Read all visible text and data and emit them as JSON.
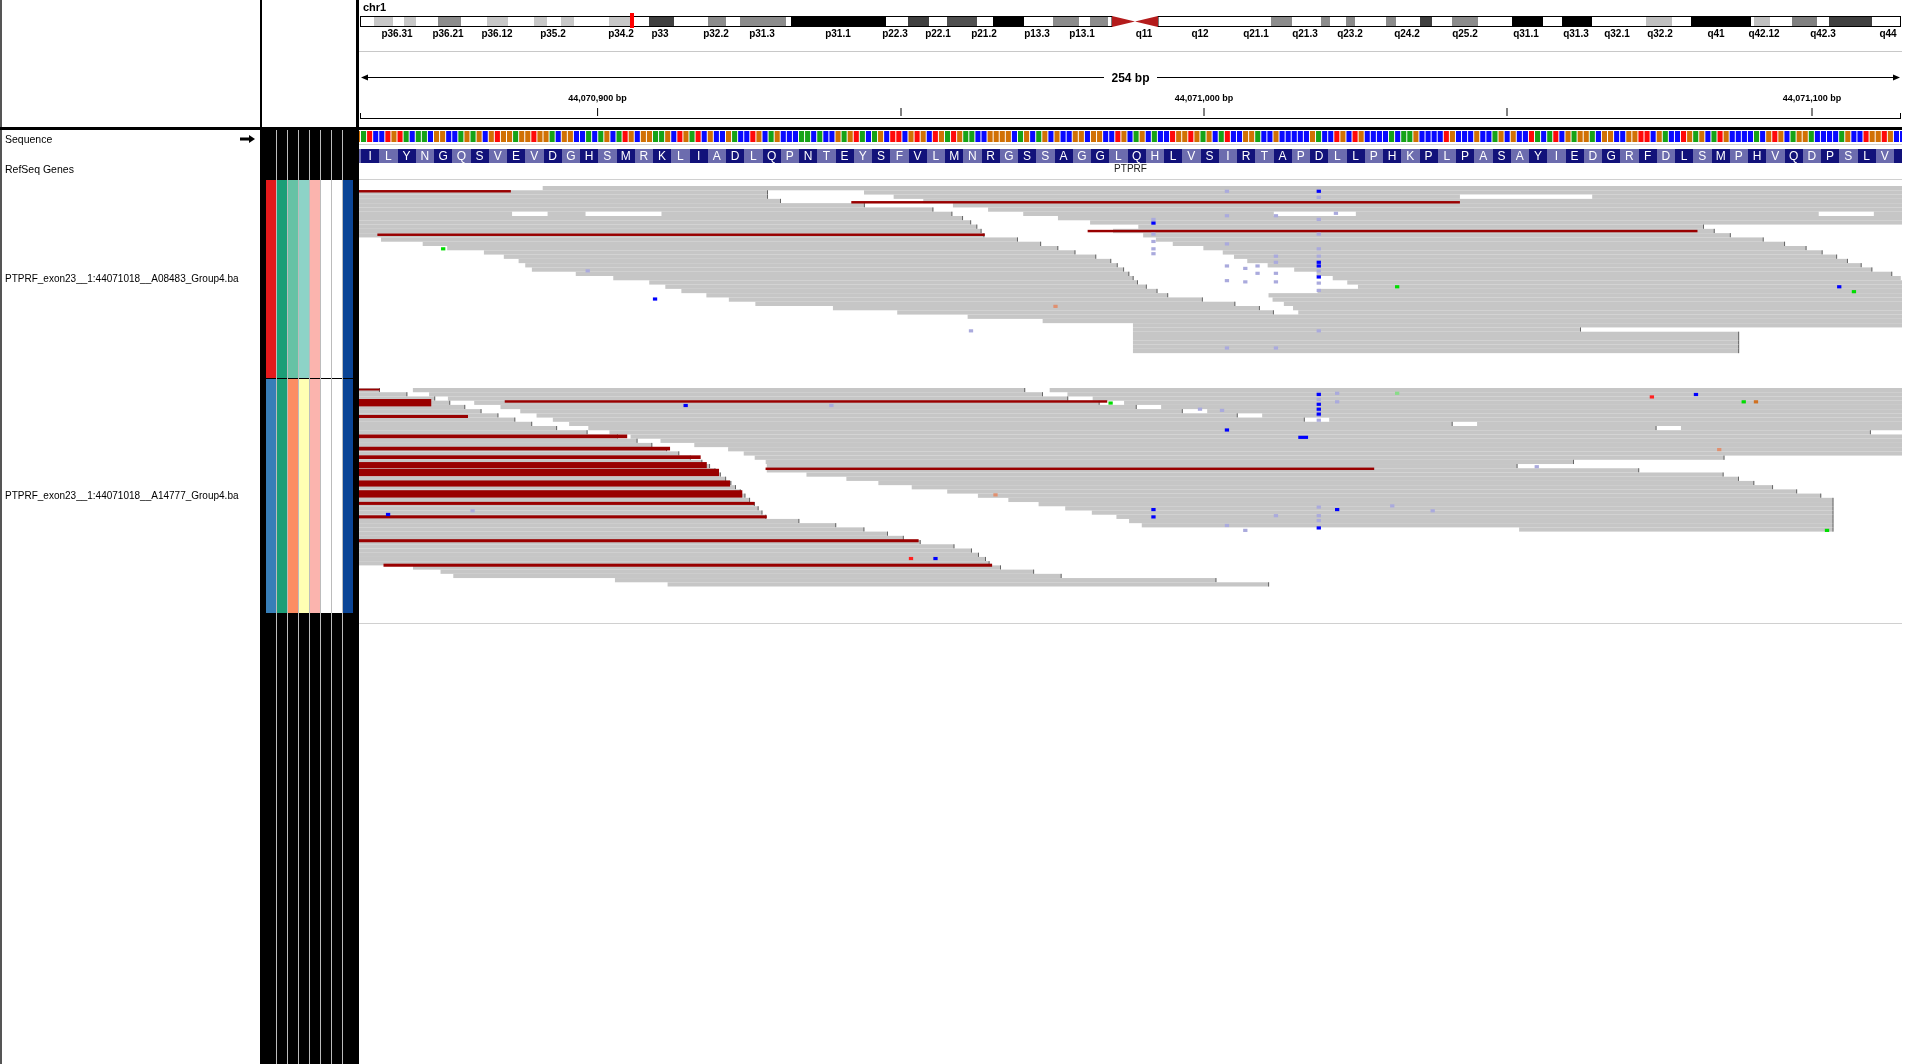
{
  "locus": {
    "chromosome": "chr1",
    "cytobands": [
      "p36.31",
      "p36.21",
      "p36.12",
      "p35.2",
      "p34.2",
      "p33",
      "p32.2",
      "p31.3",
      "p31.1",
      "p22.3",
      "p22.1",
      "p21.2",
      "p13.3",
      "p13.1",
      "q11",
      "q12",
      "q21.1",
      "q21.3",
      "q23.2",
      "q24.2",
      "q25.2",
      "q31.1",
      "q31.3",
      "q32.1",
      "q32.2",
      "q41",
      "q42.12",
      "q42.3",
      "q44"
    ]
  },
  "ruler": {
    "span": "254 bp",
    "tick_labels": [
      "44,070,900 bp",
      "44,071,000 bp",
      "44,071,100 bp"
    ]
  },
  "tracks": [
    {
      "kind": "sequence",
      "name": "Sequence",
      "forward_strand": true
    },
    {
      "kind": "gene",
      "name": "RefSeq Genes",
      "gene": "PTPRF",
      "amino_acids": [
        "I",
        "L",
        "Y",
        "N",
        "G",
        "Q",
        "S",
        "V",
        "E",
        "V",
        "D",
        "G",
        "H",
        "S",
        "M",
        "R",
        "K",
        "L",
        "I",
        "A",
        "D",
        "L",
        "Q",
        "P",
        "N",
        "T",
        "E",
        "Y",
        "S",
        "F",
        "V",
        "L",
        "M",
        "N",
        "R",
        "G",
        "S",
        "S",
        "A",
        "G",
        "G",
        "L",
        "Q",
        "H",
        "L",
        "V",
        "S",
        "I",
        "R",
        "T",
        "A",
        "P",
        "D",
        "L",
        "L",
        "P",
        "H",
        "K",
        "P",
        "L",
        "P",
        "A",
        "S",
        "A",
        "Y",
        "I",
        "E",
        "D",
        "G",
        "R",
        "F",
        "D",
        "L",
        "S",
        "M",
        "P",
        "H",
        "V",
        "Q",
        "D",
        "P",
        "S",
        "L",
        "V"
      ]
    },
    {
      "kind": "alignment",
      "name": "PTPRF_exon23__1:44071018__A08483_Group4.ba",
      "attributes": [
        {
          "color": "#e41a1c"
        },
        {
          "color": "#1b9e77"
        },
        {
          "color": "#66c2a5"
        },
        {
          "color": "#8dd3c7"
        },
        {
          "color": "#fbb4ae"
        },
        {
          "color": "#ffffff"
        },
        {
          "color": "#ffffff"
        },
        {
          "color": "#0b4596"
        }
      ]
    },
    {
      "kind": "alignment",
      "name": "PTPRF_exon23__1:44071018__A14777_Group4.ba",
      "attributes": [
        {
          "color": "#377eb8"
        },
        {
          "color": "#1b9e77"
        },
        {
          "color": "#fc8d62"
        },
        {
          "color": "#ffffb3"
        },
        {
          "color": "#fbb4ae"
        },
        {
          "color": "#ffffff"
        },
        {
          "color": "#ffffff"
        },
        {
          "color": "#0b4596"
        }
      ]
    }
  ]
}
